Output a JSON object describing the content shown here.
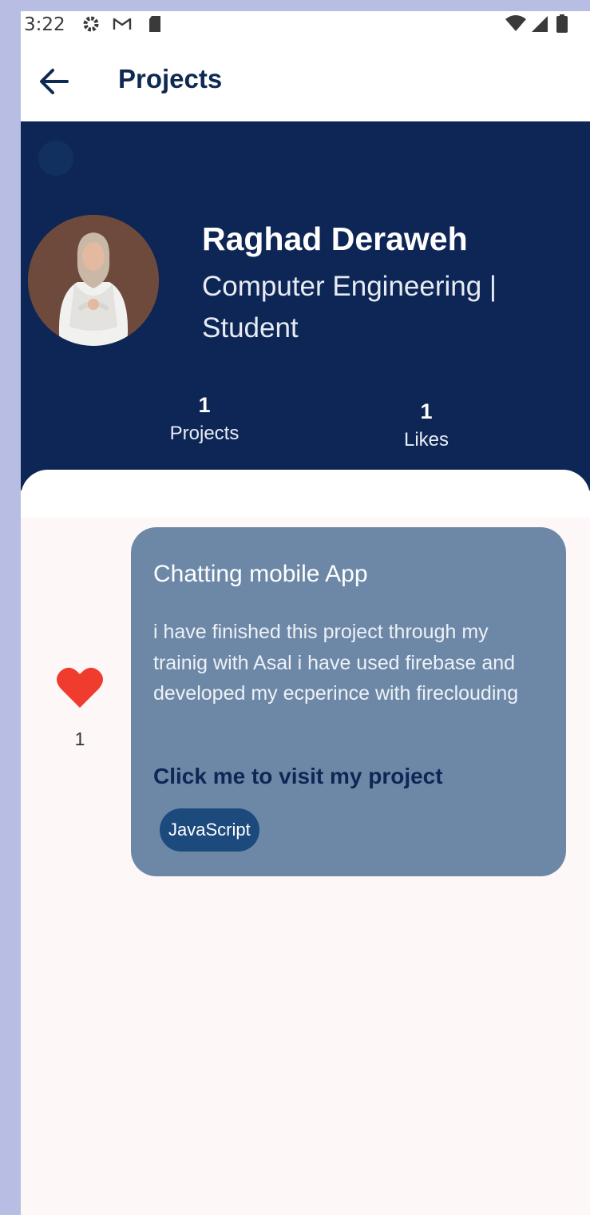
{
  "status_bar": {
    "time": "3:22",
    "left_icons": [
      "gear-icon",
      "gmail-icon",
      "sd-card-icon"
    ],
    "right_icons": [
      "wifi-icon",
      "signal-icon",
      "battery-icon"
    ]
  },
  "app_bar": {
    "title": "Projects",
    "back_icon": "arrow-back-icon"
  },
  "profile": {
    "name": "Raghad Deraweh",
    "subtitle": "Computer Engineering | Student",
    "stats": [
      {
        "value": "1",
        "label": "Projects"
      },
      {
        "value": "1",
        "label": "Likes"
      }
    ]
  },
  "projects": [
    {
      "title": "Chatting mobile App",
      "description": "i have finished this project through my trainig with Asal i have used firebase and developed my ecperince with fireclouding",
      "link_text": "Click me to visit my project",
      "tags": [
        "JavaScript"
      ],
      "likes": "1"
    }
  ],
  "colors": {
    "header_bg": "#0e2655",
    "card_bg": "#6d88a7",
    "heart": "#f03c2e",
    "chip_bg": "#1c4a7c",
    "title_text": "#0f2a52"
  }
}
